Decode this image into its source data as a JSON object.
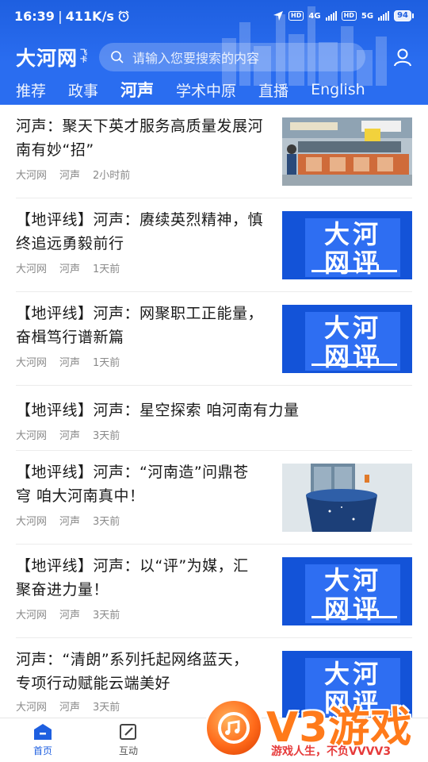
{
  "status_bar": {
    "time": "16:39",
    "net_speed": "411K/s",
    "network_label": "4G",
    "network_label_2": "5G",
    "hd_label": "HD",
    "battery": "94"
  },
  "header": {
    "logo": "大河网",
    "logo_sub": [
      "飞",
      "卡"
    ],
    "search_placeholder": "请输入您要搜索的内容",
    "tabs": [
      {
        "label": "推荐"
      },
      {
        "label": "政事"
      },
      {
        "label": "河声"
      },
      {
        "label": "学术中原"
      },
      {
        "label": "直播"
      },
      {
        "label": "English"
      }
    ],
    "active_tab": "河声"
  },
  "feed": [
    {
      "title": "河声：聚天下英才服务高质量发展河南有妙“招”",
      "source": "大河网",
      "channel": "河声",
      "time": "2小时前",
      "thumb": "photo-factory"
    },
    {
      "title": "【地评线】河声：赓续英烈精神，慎终追远勇毅前行",
      "source": "大河网",
      "channel": "河声",
      "time": "1天前",
      "thumb": "dahe-wangping"
    },
    {
      "title": "【地评线】河声：网聚职工正能量，奋楫笃行谱新篇",
      "source": "大河网",
      "channel": "河声",
      "time": "1天前",
      "thumb": "dahe-wangping"
    },
    {
      "title": "【地评线】河声：星空探索 咱河南有力量",
      "source": "大河网",
      "channel": "河声",
      "time": "3天前",
      "thumb": ""
    },
    {
      "title": "【地评线】河声：“河南造”问鼎苍穹 咱大河南真中！",
      "source": "大河网",
      "channel": "河声",
      "time": "3天前",
      "thumb": "photo-satellite"
    },
    {
      "title": "【地评线】河声：以“评”为媒，汇聚奋进力量！",
      "source": "大河网",
      "channel": "河声",
      "time": "3天前",
      "thumb": "dahe-wangping"
    },
    {
      "title": "河声：“清朗”系列托起网络蓝天，专项行动赋能云端美好",
      "source": "大河网",
      "channel": "河声",
      "time": "3天前",
      "thumb": "dahe-wangping"
    }
  ],
  "thumb_text": {
    "line1": "大河",
    "line2": "网评"
  },
  "bottom_nav": [
    {
      "label": "首页",
      "icon": "home-icon"
    },
    {
      "label": "互动",
      "icon": "edit-icon"
    }
  ],
  "watermark": {
    "brand": "V3游戏",
    "slogan": "游戏人生，不负VVVV3"
  },
  "colors": {
    "brand_blue": "#2a6df0",
    "thumb_blue": "#1353d8",
    "watermark_orange": "#ff7a1a"
  }
}
